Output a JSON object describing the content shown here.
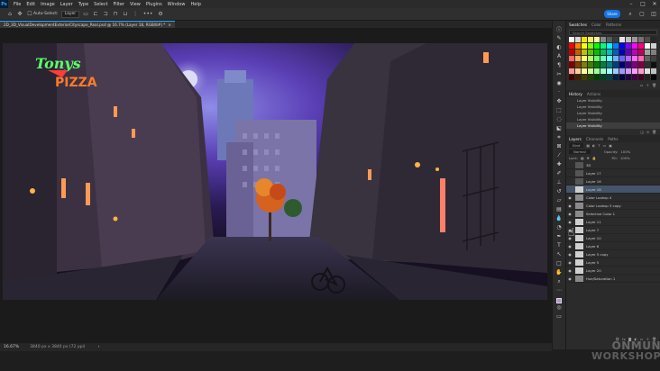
{
  "app": {
    "logo": "Ps"
  },
  "menu": [
    "File",
    "Edit",
    "Image",
    "Layer",
    "Type",
    "Select",
    "Filter",
    "View",
    "Plugins",
    "Window",
    "Help"
  ],
  "options": {
    "auto_select_label": "Auto-Select:",
    "auto_select_value": "Layer",
    "share_label": "Share",
    "more": "•••"
  },
  "document": {
    "tab_title": "2D_3D_VisualDevelopmentExteriorCityscape_Real.psd @ 16.7% (Layer 18, RGB/8#) *"
  },
  "status": {
    "zoom": "16.67%",
    "size": "3840 px x 3840 px (72 ppi)"
  },
  "artwork": {
    "sign_line1": "Tonys",
    "sign_line2": "PIZZA"
  },
  "swatches": {
    "tabs": [
      "Swatches",
      "Color",
      "Patterns"
    ],
    "search_placeholder": "Search Swatches",
    "colors": [
      "#ffffff",
      "#d9d9d9",
      "#f2e600",
      "#f7ec6b",
      "#fdf2a5",
      "#8a8a8a",
      "#5a5a5a",
      "#3a3a3a",
      "#e6e6e6",
      "#bfbfbf",
      "#9a9a9a",
      "#737373",
      "#4d4d4d",
      "#262626",
      "#ff0000",
      "#ff8000",
      "#ffff00",
      "#80ff00",
      "#00ff00",
      "#00ff80",
      "#00ffff",
      "#0080ff",
      "#0000ff",
      "#8000ff",
      "#ff00ff",
      "#ff0080",
      "#ffffff",
      "#d0d0d0",
      "#c00000",
      "#c06000",
      "#c0c000",
      "#60c000",
      "#00c000",
      "#00c060",
      "#00c0c0",
      "#0060c0",
      "#0000c0",
      "#6000c0",
      "#c000c0",
      "#c00060",
      "#a0a0a0",
      "#808080",
      "#ff6666",
      "#ffb366",
      "#ffff66",
      "#b3ff66",
      "#66ff66",
      "#66ffb3",
      "#66ffff",
      "#66b3ff",
      "#6666ff",
      "#b366ff",
      "#ff66ff",
      "#ff66b3",
      "#606060",
      "#404040",
      "#800000",
      "#804000",
      "#808000",
      "#408000",
      "#008000",
      "#008040",
      "#008080",
      "#004080",
      "#000080",
      "#400080",
      "#800080",
      "#800040",
      "#303030",
      "#101010",
      "#ff9999",
      "#ffcc99",
      "#ffff99",
      "#ccff99",
      "#99ff99",
      "#99ffcc",
      "#99ffff",
      "#99ccff",
      "#9999ff",
      "#cc99ff",
      "#ff99ff",
      "#ff99cc",
      "#e0e0e0",
      "#c0c0c0",
      "#400000",
      "#402000",
      "#404000",
      "#204000",
      "#004000",
      "#004020",
      "#004040",
      "#002040",
      "#000040",
      "#200040",
      "#400040",
      "#400020",
      "#202020",
      "#000000"
    ]
  },
  "history": {
    "tabs": [
      "History",
      "Actions"
    ],
    "items": [
      "Layer Visibility",
      "Layer Visibility",
      "Layer Visibility",
      "Layer Visibility",
      "Layer Visibility"
    ]
  },
  "layers_panel": {
    "tabs": [
      "Layers",
      "Channels",
      "Paths"
    ],
    "kind_label": "Kind",
    "blend": "Normal",
    "opacity_label": "Opacity:",
    "opacity_value": "100%",
    "lock_label": "Lock:",
    "fill_label": "Fill:",
    "fill_value": "100%",
    "layers": [
      {
        "name": "3D",
        "visible": false,
        "thumb": "dark"
      },
      {
        "name": "Layer 17",
        "visible": false,
        "thumb": "dark"
      },
      {
        "name": "Layer 16",
        "visible": false,
        "thumb": "dark"
      },
      {
        "name": "Layer 18",
        "visible": false,
        "thumb": "light",
        "selected": true
      },
      {
        "name": "Color Lookup 4",
        "visible": true,
        "thumb": "adj"
      },
      {
        "name": "Color Lookup 3 copy",
        "visible": true,
        "thumb": "adj"
      },
      {
        "name": "Selective Color 1",
        "visible": true,
        "thumb": "adj"
      },
      {
        "name": "Layer 11",
        "visible": true,
        "thumb": "light"
      },
      {
        "name": "Layer 7",
        "visible": true,
        "thumb": "light"
      },
      {
        "name": "Layer 10",
        "visible": true,
        "thumb": "light"
      },
      {
        "name": "Layer 6",
        "visible": true,
        "thumb": "light"
      },
      {
        "name": "Layer 5 copy",
        "visible": true,
        "thumb": "light"
      },
      {
        "name": "Layer 5",
        "visible": true,
        "thumb": "light"
      },
      {
        "name": "Layer 20",
        "visible": true,
        "thumb": "light"
      },
      {
        "name": "Hue/Saturation 1",
        "visible": true,
        "thumb": "adj"
      }
    ]
  },
  "watermark": {
    "line1": "ONMUN",
    "line2": "WORKSHOP"
  }
}
